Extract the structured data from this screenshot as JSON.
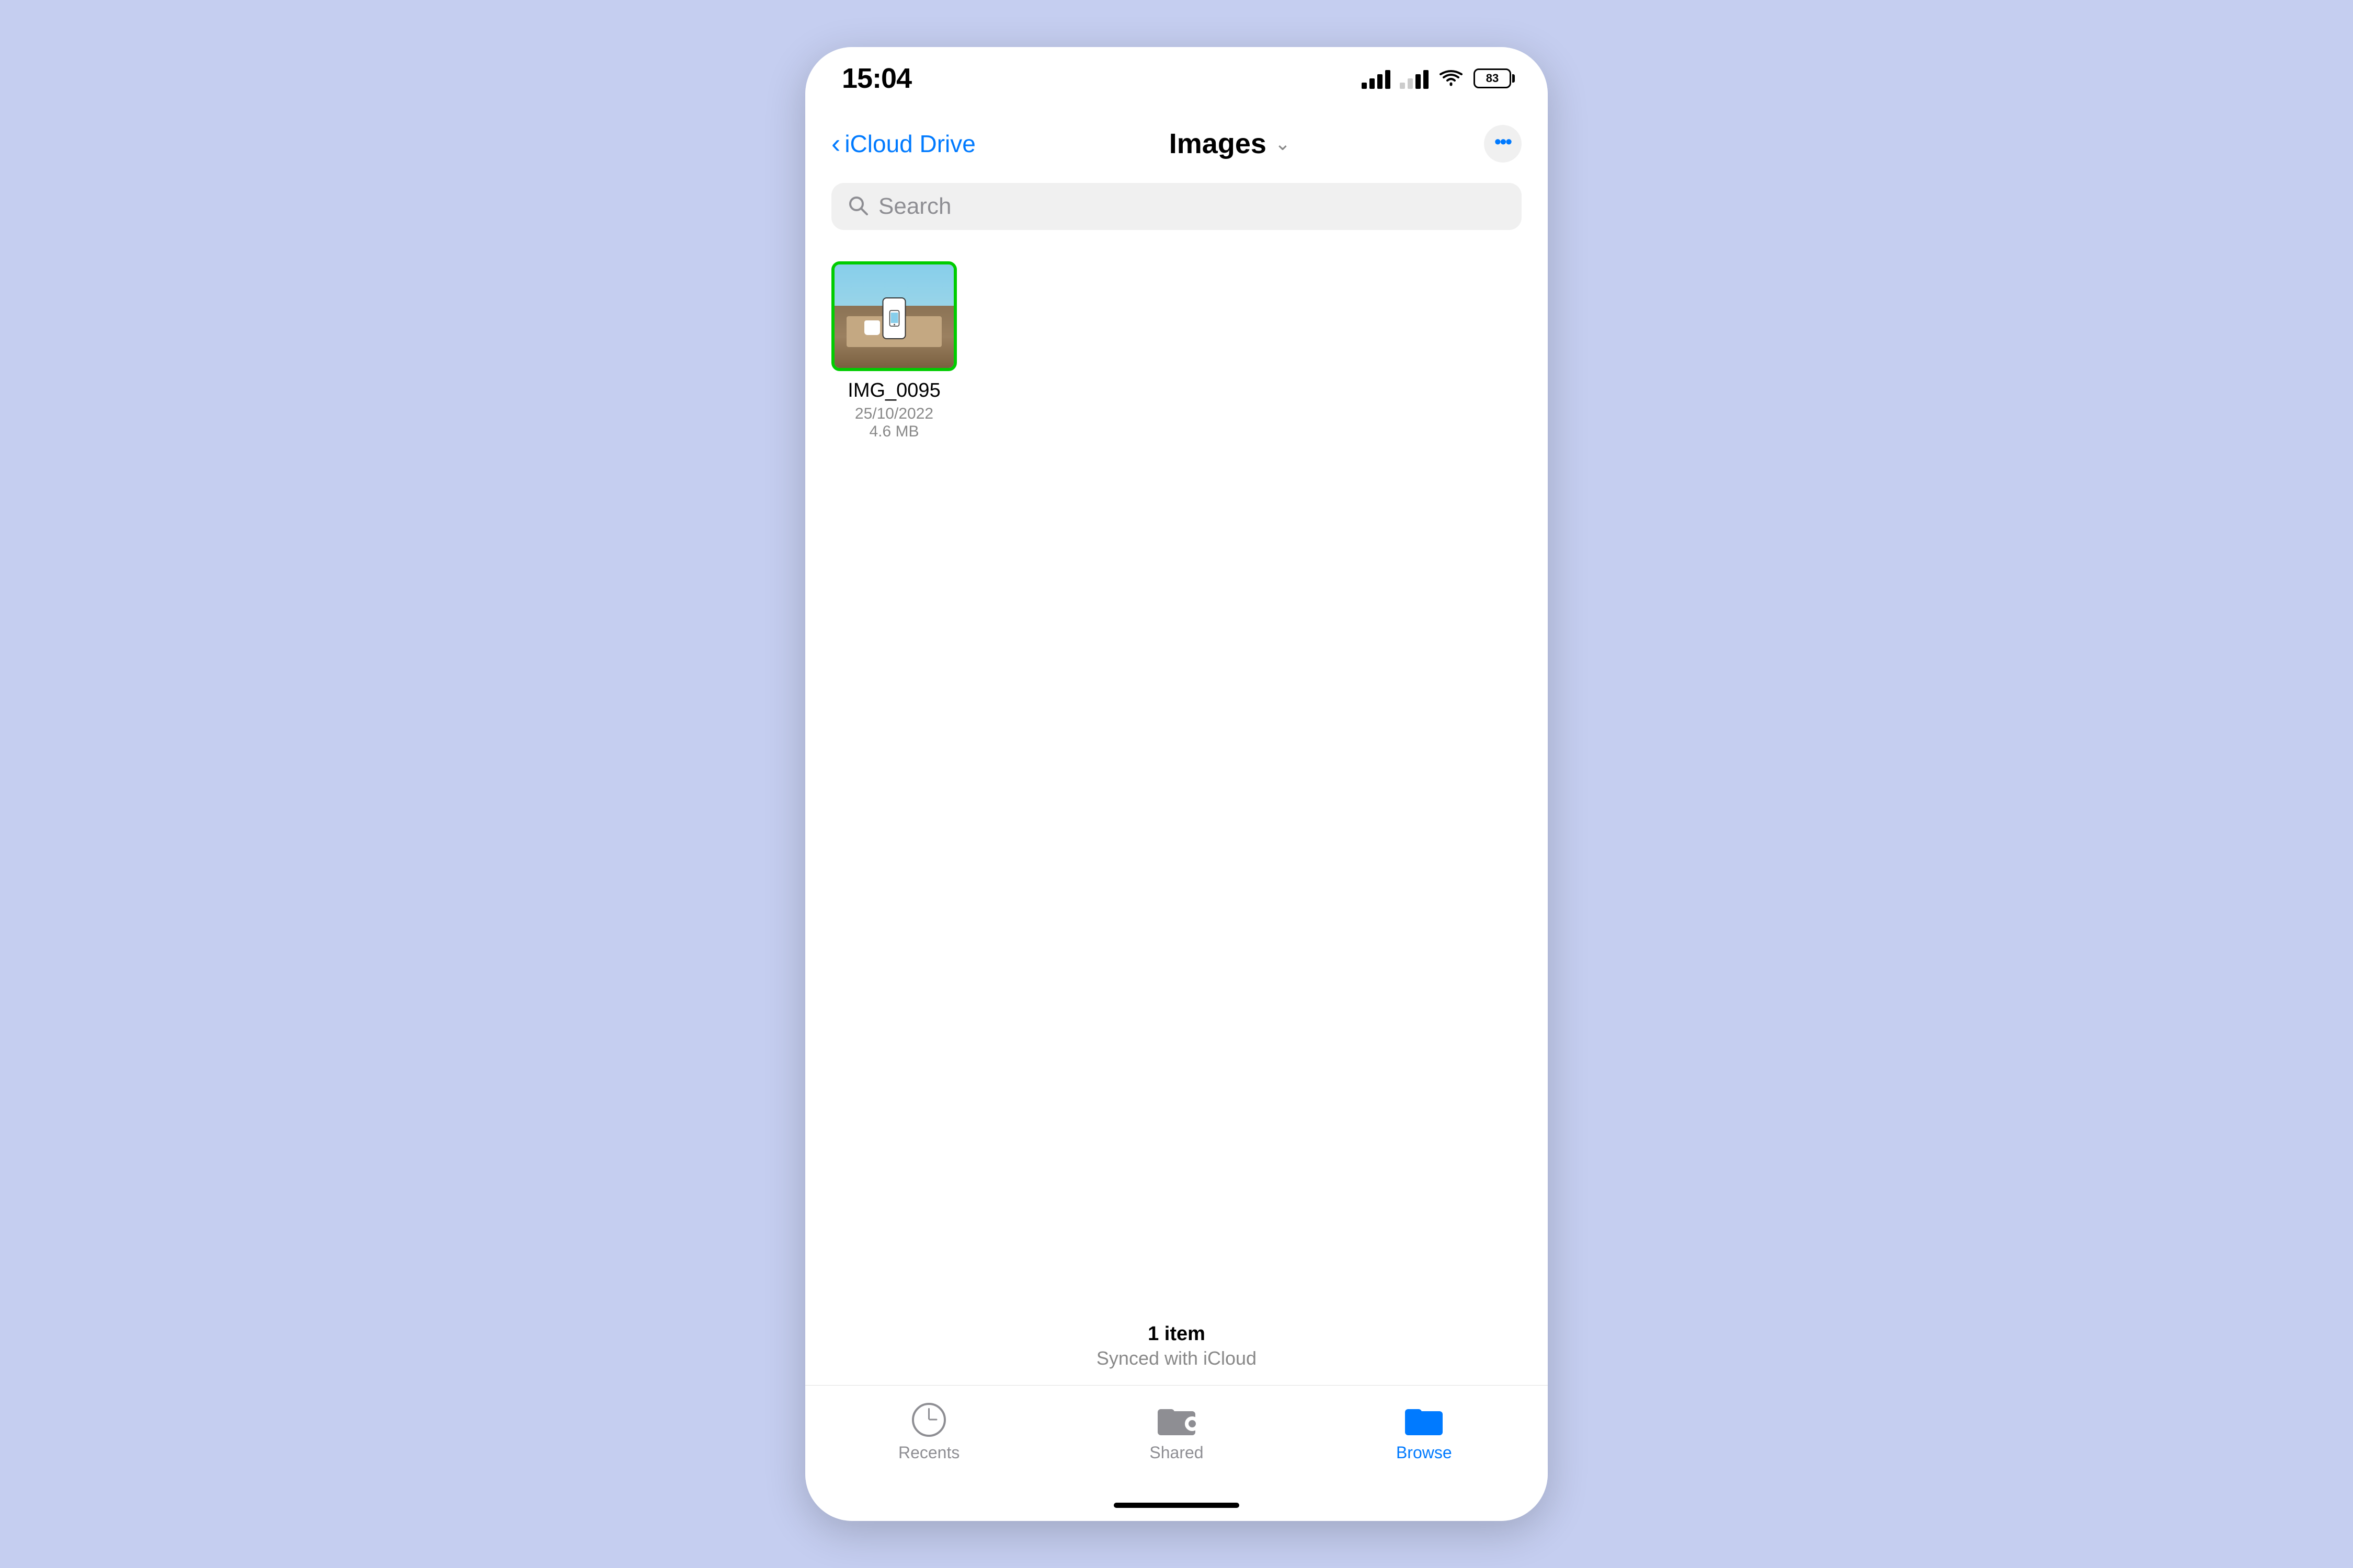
{
  "status_bar": {
    "time": "15:04",
    "battery_level": "83",
    "notification": true
  },
  "nav": {
    "back_label": "iCloud Drive",
    "title": "Images",
    "more_button_label": "More"
  },
  "search": {
    "placeholder": "Search"
  },
  "files": [
    {
      "name": "IMG_0095",
      "date": "25/10/2022",
      "size": "4.6 MB",
      "selected": true
    }
  ],
  "footer": {
    "item_count": "1 item",
    "sync_status": "Synced with iCloud"
  },
  "tab_bar": {
    "tabs": [
      {
        "id": "recents",
        "label": "Recents",
        "active": false
      },
      {
        "id": "shared",
        "label": "Shared",
        "active": false
      },
      {
        "id": "browse",
        "label": "Browse",
        "active": true
      }
    ]
  },
  "colors": {
    "accent": "#007AFF",
    "selection_border": "#00cc00",
    "inactive_tab": "#8e8e93",
    "active_tab": "#007AFF"
  }
}
